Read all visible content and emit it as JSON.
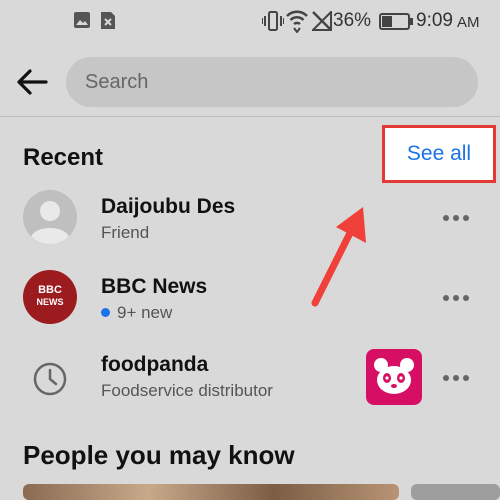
{
  "status_bar": {
    "battery": "36%",
    "time": "9:09",
    "ampm": "AM"
  },
  "search": {
    "placeholder": "Search"
  },
  "recent": {
    "title": "Recent",
    "see_all": "See all",
    "items": [
      {
        "name": "Daijoubu Des",
        "subtitle": "Friend",
        "icon": "default-avatar"
      },
      {
        "name": "BBC News",
        "subtitle": "9+ new",
        "icon": "bbc-news-logo",
        "logo_text_top": "BBC",
        "logo_text_bottom": "NEWS"
      },
      {
        "name": "foodpanda",
        "subtitle": "Foodservice distributor",
        "icon": "clock-icon"
      }
    ]
  },
  "people": {
    "title": "People you may know"
  },
  "colors": {
    "accent": "#1a73e8",
    "highlight": "#e53935",
    "foodpanda": "#d70f64",
    "bbc": "#9b1b1e"
  }
}
